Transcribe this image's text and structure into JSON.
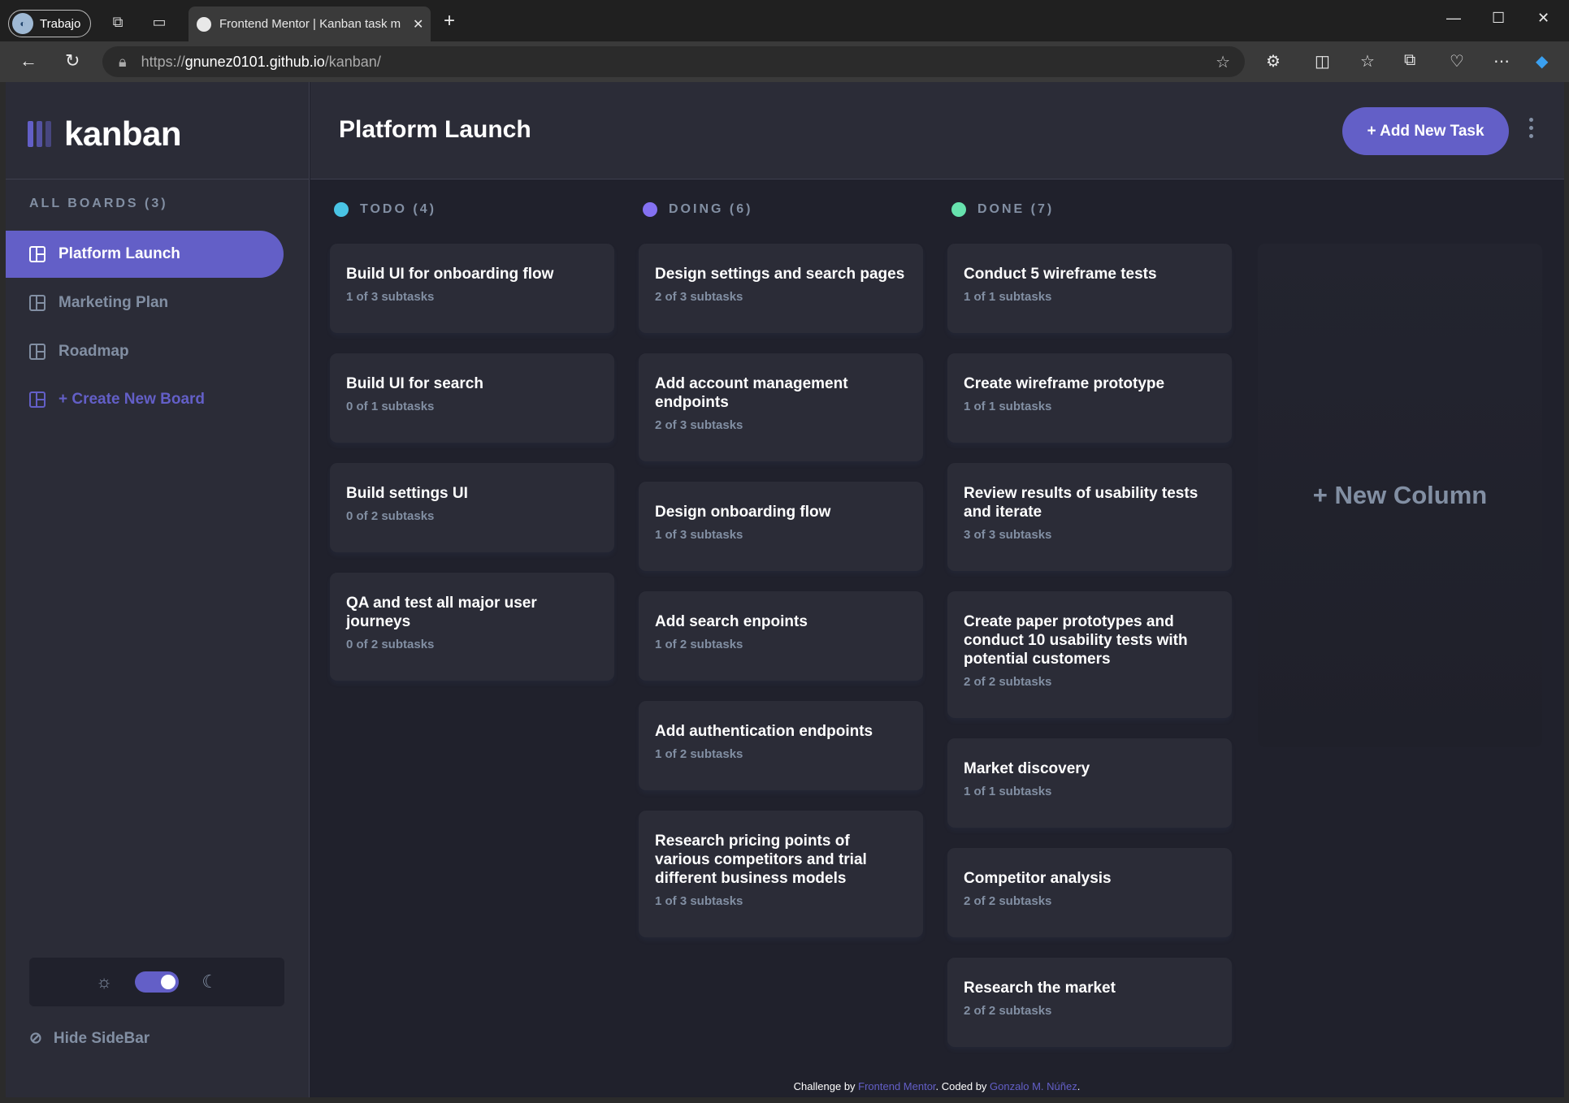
{
  "browser": {
    "profile_label": "Trabajo",
    "tab_title": "Frontend Mentor | Kanban task m",
    "url_scheme": "https://",
    "url_host": "gnunez0101.github.io",
    "url_path": "/kanban/"
  },
  "app": {
    "logo_text": "kanban",
    "all_boards_label": "ALL BOARDS (3)",
    "boards": [
      "Platform Launch",
      "Marketing Plan",
      "Roadmap"
    ],
    "create_board_label": "+ Create New Board",
    "hide_sidebar_label": "Hide SideBar",
    "board_title": "Platform Launch",
    "add_task_label": "+ Add New Task",
    "new_column_label": "+ New Column"
  },
  "columns": [
    {
      "header": "TODO (4)",
      "color": "#49c4e5",
      "cards": [
        {
          "title": "Build UI for onboarding flow",
          "subtasks": "1 of 3 subtasks"
        },
        {
          "title": "Build UI for search",
          "subtasks": "0 of 1 subtasks"
        },
        {
          "title": "Build settings UI",
          "subtasks": "0 of 2 subtasks"
        },
        {
          "title": "QA and test all major user journeys",
          "subtasks": "0 of 2 subtasks"
        }
      ]
    },
    {
      "header": "DOING (6)",
      "color": "#8471f2",
      "cards": [
        {
          "title": "Design settings and search pages",
          "subtasks": "2 of 3 subtasks"
        },
        {
          "title": "Add account management endpoints",
          "subtasks": "2 of 3 subtasks"
        },
        {
          "title": "Design onboarding flow",
          "subtasks": "1 of 3 subtasks"
        },
        {
          "title": "Add search enpoints",
          "subtasks": "1 of 2 subtasks"
        },
        {
          "title": "Add authentication endpoints",
          "subtasks": "1 of 2 subtasks"
        },
        {
          "title": "Research pricing points of various competitors and trial different business models",
          "subtasks": "1 of 3 subtasks"
        }
      ]
    },
    {
      "header": "DONE (7)",
      "color": "#67e2ae",
      "cards": [
        {
          "title": "Conduct 5 wireframe tests",
          "subtasks": "1 of 1 subtasks"
        },
        {
          "title": "Create wireframe prototype",
          "subtasks": "1 of 1 subtasks"
        },
        {
          "title": "Review results of usability tests and iterate",
          "subtasks": "3 of 3 subtasks"
        },
        {
          "title": "Create paper prototypes and conduct 10 usability tests with potential customers",
          "subtasks": "2 of 2 subtasks"
        },
        {
          "title": "Market discovery",
          "subtasks": "1 of 1 subtasks"
        },
        {
          "title": "Competitor analysis",
          "subtasks": "2 of 2 subtasks"
        },
        {
          "title": "Research the market",
          "subtasks": "2 of 2 subtasks"
        }
      ]
    }
  ],
  "footer": {
    "prefix": "Challenge by ",
    "link1": "Frontend Mentor",
    "middle": ". Coded by ",
    "link2": "Gonzalo M. Núñez",
    "suffix": "."
  },
  "colors": {
    "accent": "#635fc7",
    "bg": "#20212c",
    "panel": "#2b2c37",
    "muted": "#828fa3"
  }
}
